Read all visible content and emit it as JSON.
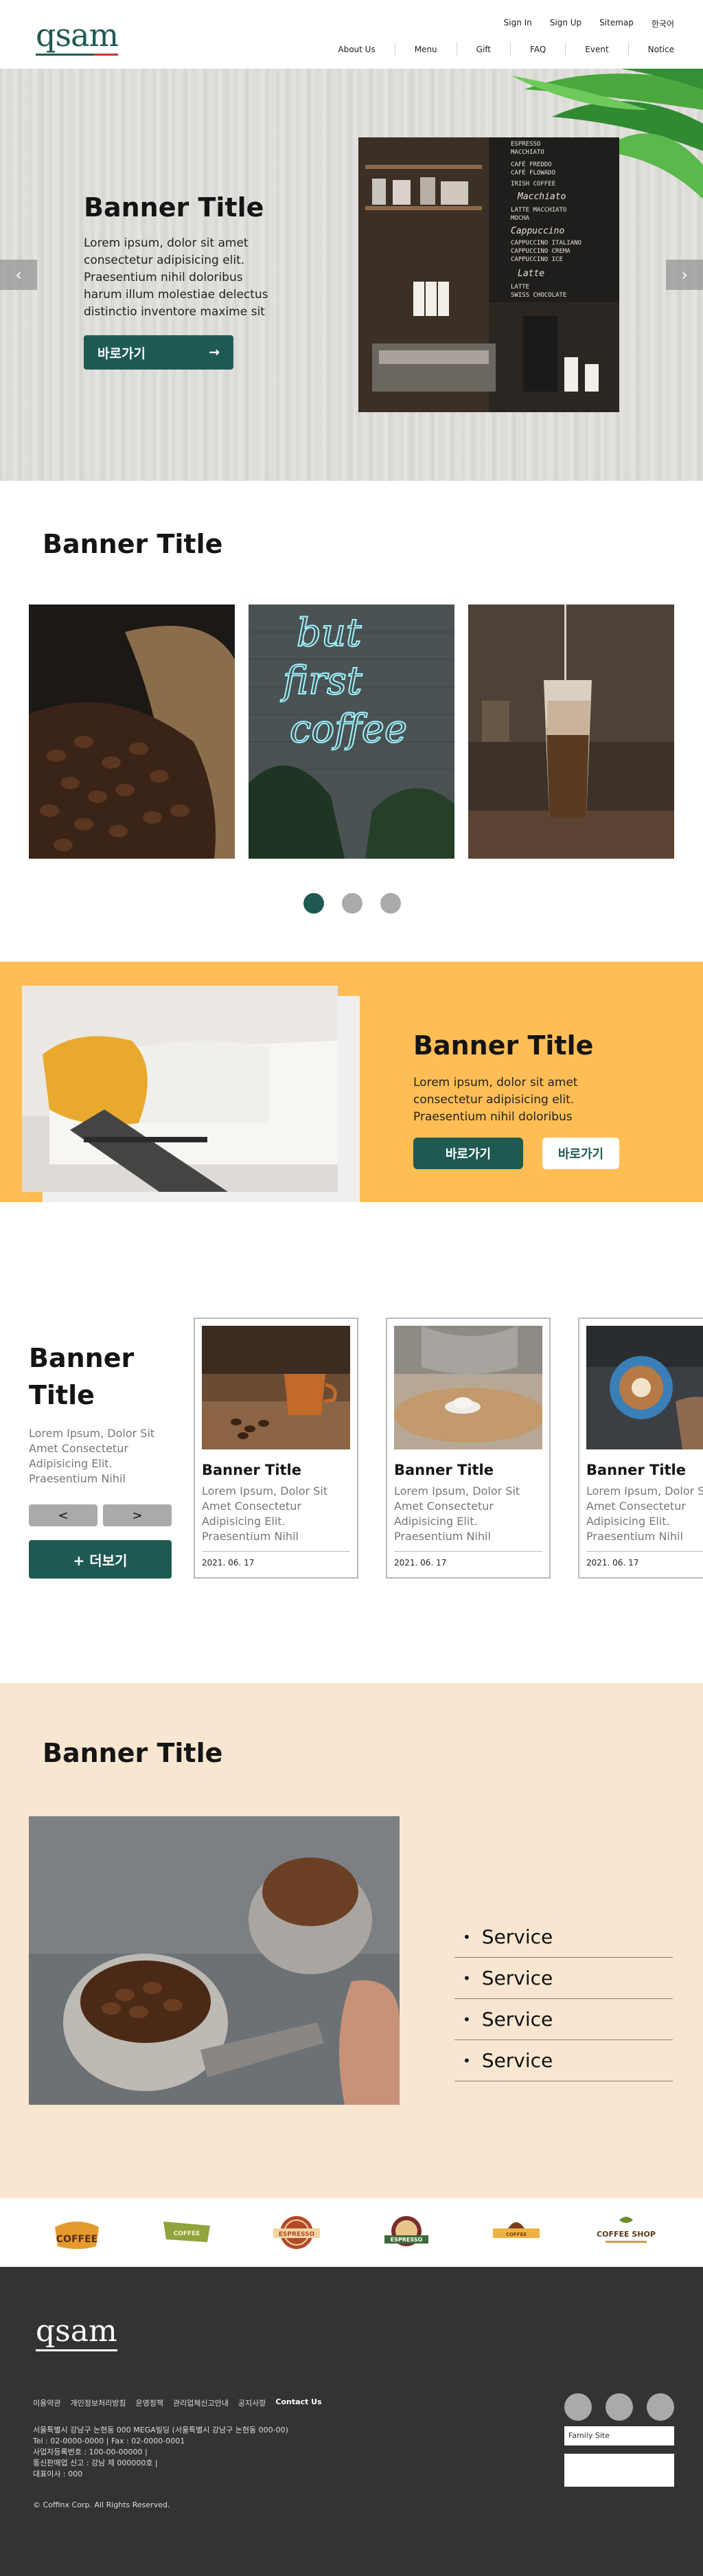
{
  "header": {
    "logo": "qsam",
    "util_links": [
      "Sign In",
      "Sign Up",
      "Sitemap",
      "한국어"
    ],
    "nav": [
      "About Us",
      "Menu",
      "Gift",
      "FAQ",
      "Event",
      "Notice"
    ]
  },
  "hero": {
    "title": "Banner Title",
    "text": "Lorem ipsum, dolor sit amet consectetur adipisicing elit. Praesentium nihil doloribus harum illum molestiae delectus distinctio inventore maxime sit",
    "button": "바로가기",
    "button_icon": "arrow-right-icon",
    "prev_icon": "chevron-left-icon",
    "next_icon": "chevron-right-icon",
    "chalkboard": [
      "ESPRESSO",
      "MACCHIATO",
      "CAFÉ FREDDO",
      "CAFÉ FLOWADO",
      "IRISH COFFEE",
      "Macchiato",
      "LATTE MACCHIATO",
      "MOCHA",
      "Cappuccino",
      "CAPPUCCINO ITALIANO",
      "CAPPUCCINO CREMA",
      "CAPPUCCINO ICE",
      "Latte",
      "LATTE",
      "SWISS CHOCOLATE"
    ]
  },
  "section2": {
    "title": "Banner Title",
    "neon_text": [
      "but",
      "first",
      "coffee"
    ],
    "dots": 3,
    "active_dot": 0
  },
  "section3": {
    "title": "Banner Title",
    "text": "Lorem ipsum, dolor sit amet consectetur adipisicing elit. Praesentium nihil doloribus",
    "button_primary": "바로가기",
    "button_secondary": "바로가기"
  },
  "section4": {
    "title": "Banner Title",
    "text": "Lorem Ipsum, Dolor Sit Amet Consectetur Adipisicing Elit. Praesentium Nihil",
    "prev": "<",
    "next": ">",
    "more": "+ 더보기",
    "cards": [
      {
        "title": "Banner Title",
        "desc": [
          "Lorem Ipsum, Dolor Sit",
          "Amet Consectetur",
          "Adipisicing Elit.",
          "Praesentium Nihil"
        ],
        "date": "2021. 06. 17"
      },
      {
        "title": "Banner Title",
        "desc": [
          "Lorem Ipsum, Dolor Sit",
          "Amet Consectetur",
          "Adipisicing Elit.",
          "Praesentium Nihil"
        ],
        "date": "2021. 06. 17"
      },
      {
        "title": "Banner Title",
        "desc": [
          "Lorem Ipsum, Dolor Sit",
          "Amet Consectetur",
          "Adipisicing Elit.",
          "Praesentium Nihil"
        ],
        "date": "2021. 06. 17"
      }
    ]
  },
  "section5": {
    "title": "Banner Title",
    "services": [
      "Service",
      "Service",
      "Service",
      "Service"
    ]
  },
  "brands": [
    "COFFEE",
    "COFFEE",
    "ESPRESSO",
    "ESPRESSO",
    "COFFEE",
    "COFFEE SHOP"
  ],
  "footer": {
    "logo": "qsam",
    "menu": [
      "이용약관",
      "개인정보처리방침",
      "운영정책",
      "관리업체신고안내",
      "공지사항",
      "Contact Us"
    ],
    "info": [
      "서울특별시 강남구 논현동 000 MEGA빌딩 (서울특별시 강남구 논현동 000-00)",
      "Tel : 02-0000-0000  |  Fax : 02-0000-0001",
      "사업자등록번호 : 100-00-00000  |",
      "통신판매업 신고 : 강남 제 000000호  |",
      "대표이사 : 000"
    ],
    "copyright": "© Coffinx Corp. All Rights Reserved.",
    "family_site": "Family Site"
  },
  "colors": {
    "brand": "#1f5a52",
    "accent": "#ffbe55",
    "cream": "#f8e6d1",
    "footer": "#333333"
  }
}
